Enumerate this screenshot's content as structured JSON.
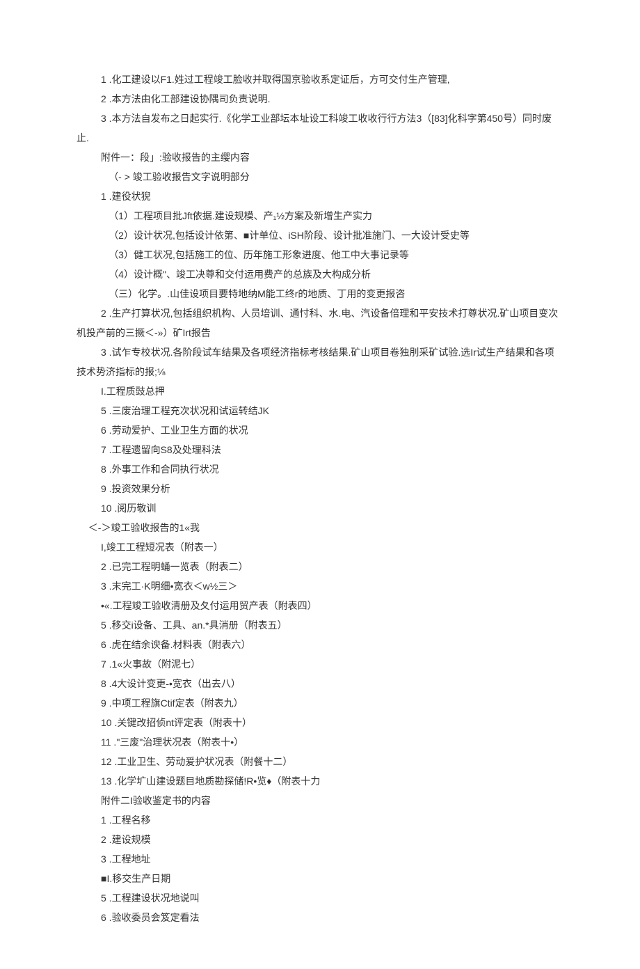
{
  "lines": [
    {
      "cls": "indent1",
      "text": "1 .化工建设以F1.姓过工程竣工脸收并取得国京验收系定证后，方可交付生产管理,"
    },
    {
      "cls": "indent1",
      "text": "2 .本方法由化工部建设协隅司负责说明."
    },
    {
      "cls": "indent1",
      "text": "3 .本方法自发布之日起实行.《化学工业部坛本址设工科竣工收收行行方法3（[83]化科字第450号）同时废止."
    },
    {
      "cls": "indent1",
      "text": "附件一：段」:验收报告的主缨内容"
    },
    {
      "cls": "indent2",
      "text": "（- > 竣工验收报告文字说明部分"
    },
    {
      "cls": "indent1",
      "text": "1 .建役状猊"
    },
    {
      "cls": "indent2",
      "text": "（1）工程项目批Jft依据.建设规模、产₁½方案及新增生产实力"
    },
    {
      "cls": "indent2",
      "text": "（2）设计状况,包括设计依第、■计单位、iSH阶段、设计批准施门、一大设计受史等"
    },
    {
      "cls": "indent2",
      "text": "（3）健工状况,包括施工的位、历年施工形象进度、他工中大事记录等"
    },
    {
      "cls": "indent2",
      "text": "（4）设计概\"、竣工决尊和交付运用费产的总族及大构成分析"
    },
    {
      "cls": "indent2",
      "text": "（三）化学。.山佳设项目要特地纳M能工终r的地质、丁用的变更报咨"
    },
    {
      "cls": "indent1",
      "text": "2 .生产打算状况,包括组织机构、人员培训、通忖科、水.电、汽设备倍理和平安技术打尊状况.矿山项目变次机投产前的三撅＜-»）矿Irt报告"
    },
    {
      "cls": "indent1",
      "text": "3 .试乍专校状况.各阶段试车结果及各项经济指标考核结果.矿山项目卷独刖采矿试验.选Ir试生产结果和各项技术势济指标的报;⅛"
    },
    {
      "cls": "indent1",
      "text": "I.工程质豉总押"
    },
    {
      "cls": "indent1",
      "text": "5 .三废治理工程充次状况和试运转结JK"
    },
    {
      "cls": "indent1",
      "text": "6 .劳动爱护、工业卫生方面的状况"
    },
    {
      "cls": "indent1",
      "text": "7 .工程遗留向S8及处理科法"
    },
    {
      "cls": "indent1",
      "text": "8 .外事工作和合同执行状况"
    },
    {
      "cls": "indent1",
      "text": "9 .投资效果分析"
    },
    {
      "cls": "indent1",
      "text": "10 .阅历敬训"
    },
    {
      "cls": "indent3",
      "text": "＜-＞竣工验收报告的1«我"
    },
    {
      "cls": "indent1",
      "text": "I,竣工工程短况表（附表一）"
    },
    {
      "cls": "indent1",
      "text": "2 .已完工程明蛹一览表（附表二）"
    },
    {
      "cls": "indent1",
      "text": "3 .末完工·K明细•宽衣＜w½三＞"
    },
    {
      "cls": "indent1",
      "text": "•«.工程竣工验收清册及夂付运用贸产表（附表四）"
    },
    {
      "cls": "indent1",
      "text": "5 .移交i设备、工具、an.*具消册（附表五）"
    },
    {
      "cls": "indent1",
      "text": "6 .虎在结余谀备.材料表（附表六）"
    },
    {
      "cls": "indent1",
      "text": "7 .1«火事故（附泥七）"
    },
    {
      "cls": "indent1",
      "text": "8 .4大设计变更-•宽衣（出去八）"
    },
    {
      "cls": "indent1",
      "text": "9 .中项工程旗Ctif定表（附表九）"
    },
    {
      "cls": "indent1",
      "text": "10 .关键改招侦nt评定表（附表十）"
    },
    {
      "cls": "indent1",
      "text": "11 .\"三废\"治理状况表（附表十•）"
    },
    {
      "cls": "indent1",
      "text": "12 .工业卫生、劳动爰护状况表（附餐十二）"
    },
    {
      "cls": "indent1",
      "text": "13 .化学圹山建设题目地质勘探储!R•览♦（附表十力"
    },
    {
      "cls": "indent1",
      "text": "附件二I验收鉴定书的内容"
    },
    {
      "cls": "indent1",
      "text": "1 .工程名移"
    },
    {
      "cls": "indent1",
      "text": "2 .建设规模"
    },
    {
      "cls": "indent1",
      "text": "3 .工程地址"
    },
    {
      "cls": "indent1",
      "text": "■I.移交生产日期"
    },
    {
      "cls": "indent1",
      "text": "5 .工程建设状况地说叫"
    },
    {
      "cls": "indent1",
      "text": "6 .验收委员会笈定看法"
    }
  ]
}
